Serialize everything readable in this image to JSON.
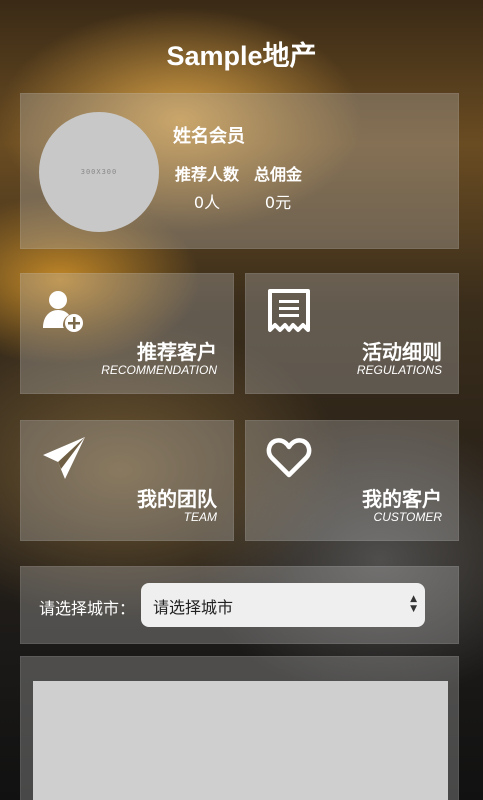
{
  "header": {
    "title": "Sample地产"
  },
  "profile": {
    "avatar_text": "300X300",
    "name": "姓名会员",
    "referrals_label": "推荐人数",
    "referrals_value": "0人",
    "commission_label": "总佣金",
    "commission_value": "0元"
  },
  "tiles": [
    {
      "zh": "推荐客户",
      "en": "RECOMMENDATION",
      "icon": "add-user-icon"
    },
    {
      "zh": "活动细则",
      "en": "REGULATIONS",
      "icon": "receipt-icon"
    },
    {
      "zh": "我的团队",
      "en": "TEAM",
      "icon": "paper-plane-icon"
    },
    {
      "zh": "我的客户",
      "en": "CUSTOMER",
      "icon": "heart-icon"
    }
  ],
  "city": {
    "label": "请选择城市：",
    "selected": "请选择城市"
  }
}
